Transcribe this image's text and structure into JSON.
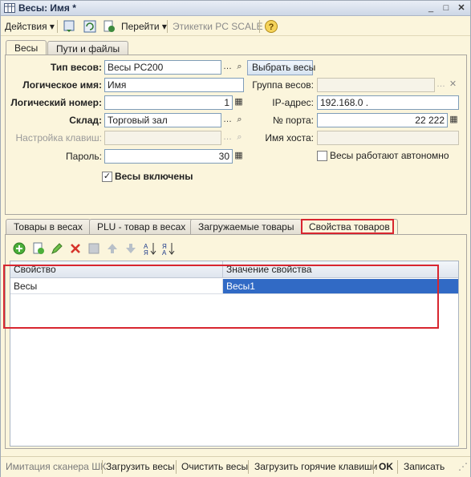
{
  "window": {
    "title": "Весы: Имя *"
  },
  "toolbar": {
    "actions_label": "Действия",
    "goto_label": "Перейти",
    "labels_label": "Этикетки PC SCALE"
  },
  "tabs": [
    {
      "label": "Весы"
    },
    {
      "label": "Пути и файлы"
    }
  ],
  "form": {
    "scale_type_label": "Тип весов:",
    "scale_type_value": "Весы PC200",
    "choose_scale_button": "Выбрать весы",
    "logical_name_label": "Логическое имя:",
    "logical_name_value": "Имя",
    "scale_group_label": "Группа весов:",
    "scale_group_value": "",
    "logical_number_label": "Логический номер:",
    "logical_number_value": "1",
    "ip_label": "IP-адрес:",
    "ip_value": "192.168.0  .",
    "warehouse_label": "Склад:",
    "warehouse_value": "Торговый зал",
    "port_label": "№ порта:",
    "port_value": "22 222",
    "keys_setup_label": "Настройка клавиш:",
    "keys_setup_value": "",
    "host_label": "Имя хоста:",
    "host_value": "",
    "password_label": "Пароль:",
    "password_value": "30",
    "autonomous_label": "Весы работают автономно",
    "enabled_label": "Весы включены"
  },
  "lower_tabs": [
    {
      "label": "Товары в весах"
    },
    {
      "label": "PLU - товар в весах"
    },
    {
      "label": "Загружаемые товары"
    },
    {
      "label": "Свойства товаров"
    }
  ],
  "grid": {
    "columns": [
      "Свойство",
      "Значение свойства"
    ],
    "rows": [
      {
        "property": "Весы",
        "value": "Весы1"
      }
    ]
  },
  "statusbar": {
    "scanner_sim": "Имитация сканера ШК",
    "load_scales": "Загрузить весы",
    "clear_scales": "Очистить весы",
    "load_hotkeys": "Загрузить горячие клавиши",
    "ok": "OK",
    "write": "Записать"
  },
  "colors": {
    "background": "#fbf5dc",
    "selection": "#316ac5",
    "highlight_border": "#d8262f"
  }
}
